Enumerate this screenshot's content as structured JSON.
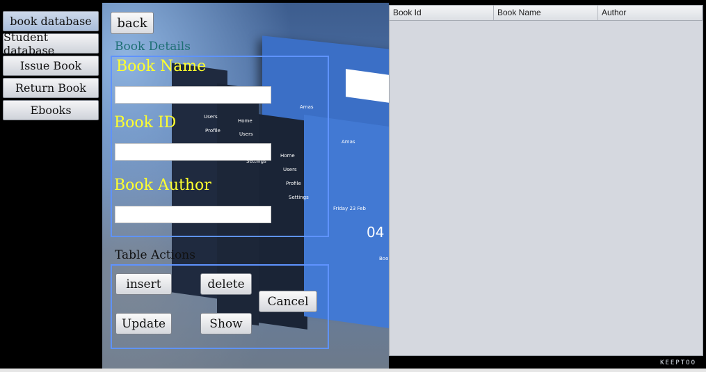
{
  "sidebar": {
    "items": [
      {
        "label": "book database"
      },
      {
        "label": "Student database"
      },
      {
        "label": "Issue Book"
      },
      {
        "label": "Return Book"
      },
      {
        "label": "Ebooks"
      }
    ]
  },
  "main": {
    "back_label": "back",
    "details_title": "Book Details",
    "fields": [
      {
        "label": "Book Name",
        "value": ""
      },
      {
        "label": "Book ID",
        "value": ""
      },
      {
        "label": "Book Author",
        "value": ""
      }
    ],
    "actions_title": "Table Actions",
    "actions": {
      "insert": "insert",
      "delete": "delete",
      "cancel": "Cancel",
      "update": "Update",
      "show": "Show"
    }
  },
  "background_art": {
    "users": "Users",
    "profile": "Profile",
    "home": "Home",
    "settings": "Settings",
    "name": "Amas",
    "date": "Friday 23 Feb",
    "number": "04",
    "book": "Book"
  },
  "table": {
    "columns": [
      "Book Id",
      "Book Name",
      "Author"
    ],
    "rows": []
  },
  "brand": "KEEPTOO",
  "colors": {
    "field_label": "#ffff2e",
    "details_title": "#1e6f74",
    "box_border": "#5f93ff",
    "table_bg": "#d5d8df"
  }
}
